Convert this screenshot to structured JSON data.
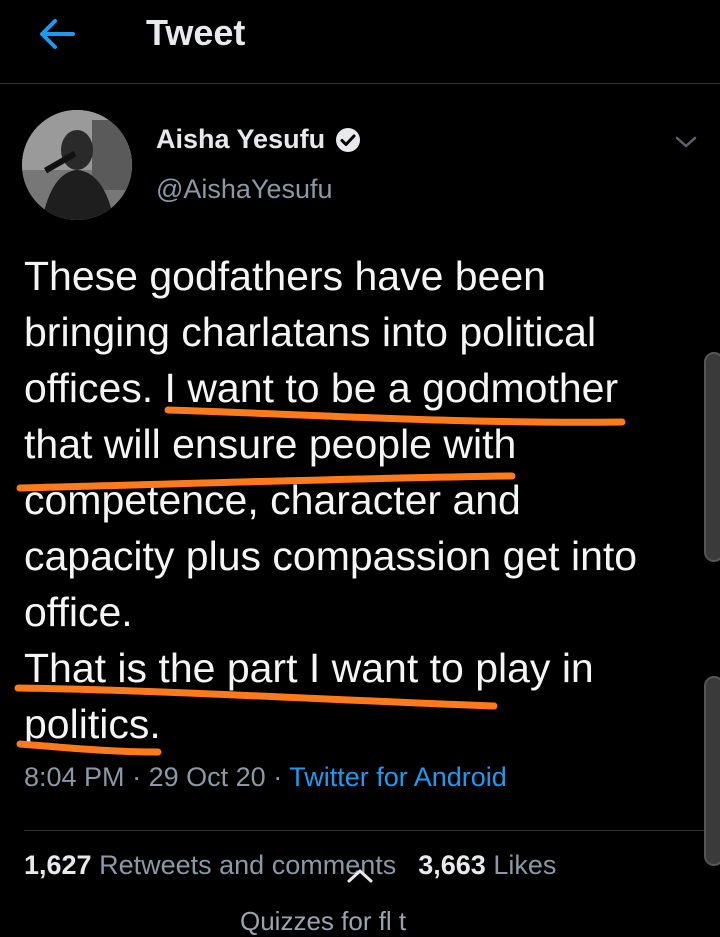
{
  "header": {
    "title": "Tweet",
    "back_icon": "arrow-left-icon"
  },
  "author": {
    "name": "Aisha Yesufu",
    "handle": "@AishaYesufu",
    "verified_icon": "verified-badge-icon"
  },
  "tweet": {
    "text": "These godfathers have been\nbringing charlatans into political\noffices. I want to be a godmother\nthat will ensure people with\ncompetence, character and\ncapacity plus compassion get into\noffice.",
    "text2": "That is the part I want to play in\npolitics.",
    "time": "8:04 PM",
    "date": "29 Oct 20",
    "source": "Twitter for Android",
    "separator": "·"
  },
  "stats": {
    "retweets_count": "1,627",
    "retweets_label": "Retweets and comments",
    "likes_count": "3,663",
    "likes_label": "Likes"
  },
  "cut_off_text": "Quizzes for fl t",
  "colors": {
    "background": "#000000",
    "link": "#1d9bf0",
    "secondary": "#8b98a5",
    "annotation": "#ff7a1a"
  }
}
